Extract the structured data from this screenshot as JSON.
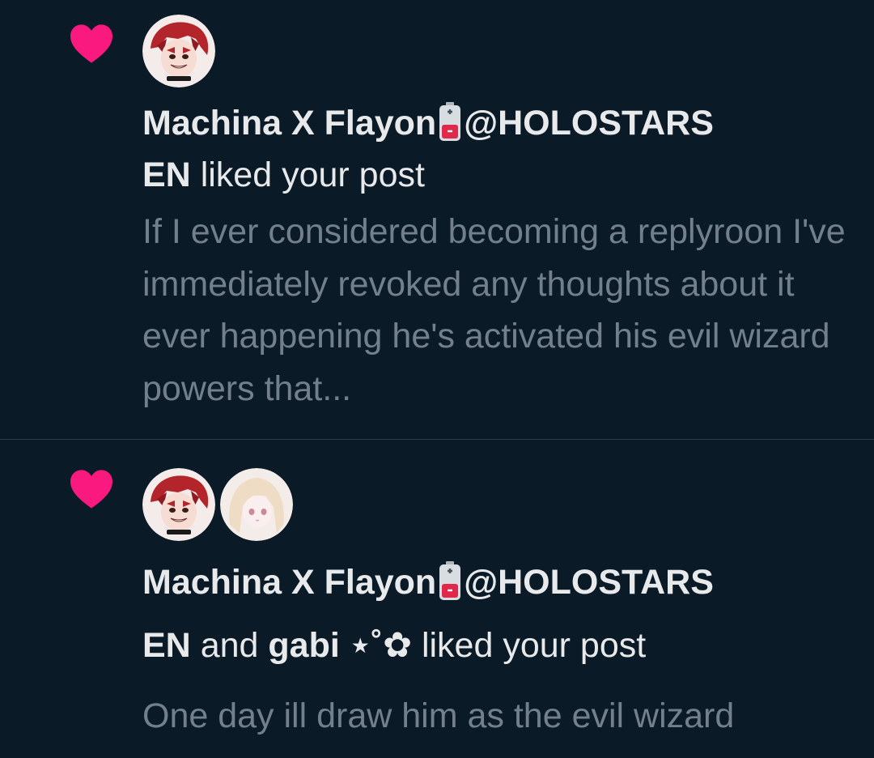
{
  "colors": {
    "background": "#0b1a27",
    "heart": "#f9197f",
    "primary_text": "#e7e9ea",
    "secondary_text": "#71808c",
    "divider": "#2f3a44"
  },
  "notifications": [
    {
      "icon": "heart-icon",
      "user_name": "Machina X Flayon",
      "name_emoji": "battery-icon",
      "user_handle_part1": "@HOLOSTARS",
      "user_handle_part2": "EN",
      "action": "liked your post",
      "snippet": "If I ever considered becoming a replyroon I've immediately revoked any thoughts about it ever happening he's activated his evil wizard powers that..."
    },
    {
      "icon": "heart-icon",
      "user_name": "Machina X Flayon",
      "name_emoji": "battery-icon",
      "user_handle_part1": "@HOLOSTARS",
      "user_handle_part2": "EN",
      "connector": "and",
      "other_user": "gabi ⋆˚✿",
      "action": "liked your post",
      "snippet": "One day ill draw him as the evil wizard"
    }
  ]
}
